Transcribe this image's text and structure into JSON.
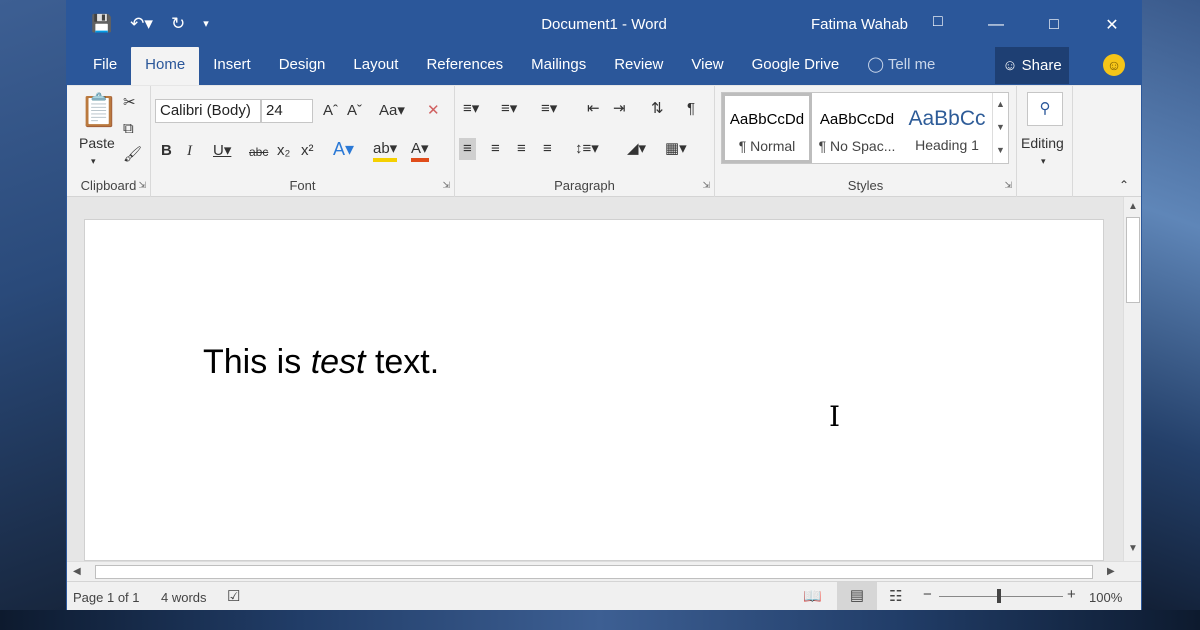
{
  "window": {
    "title": "Document1  -  Word",
    "user": "Fatima Wahab",
    "colors": {
      "accent": "#2b579a"
    }
  },
  "qat": {
    "save_icon": "save-icon",
    "undo_icon": "undo-icon",
    "redo_icon": "redo-icon",
    "customize_icon": "customize-icon"
  },
  "tabs": [
    {
      "label": "File"
    },
    {
      "label": "Home"
    },
    {
      "label": "Insert"
    },
    {
      "label": "Design"
    },
    {
      "label": "Layout"
    },
    {
      "label": "References"
    },
    {
      "label": "Mailings"
    },
    {
      "label": "Review"
    },
    {
      "label": "View"
    },
    {
      "label": "Google Drive"
    },
    {
      "label": "Tell me"
    }
  ],
  "share": {
    "label": "Share"
  },
  "ribbon": {
    "clipboard": {
      "paste": "Paste",
      "label": "Clipboard"
    },
    "font": {
      "name": "Calibri (Body)",
      "size": "24",
      "label": "Font",
      "case": "Aa"
    },
    "paragraph": {
      "label": "Paragraph"
    },
    "styles": {
      "label": "Styles",
      "items": [
        {
          "preview": "AaBbCcDd",
          "name": "¶ Normal"
        },
        {
          "preview": "AaBbCcDd",
          "name": "¶ No Spac..."
        },
        {
          "preview": "AaBbCc",
          "name": "Heading 1"
        }
      ]
    },
    "editing": {
      "label": "Editing"
    }
  },
  "document": {
    "text_before": "This is ",
    "text_italic": "test",
    "text_after": " text."
  },
  "status": {
    "page": "Page 1 of 1",
    "words": "4 words",
    "zoom": "100%"
  }
}
